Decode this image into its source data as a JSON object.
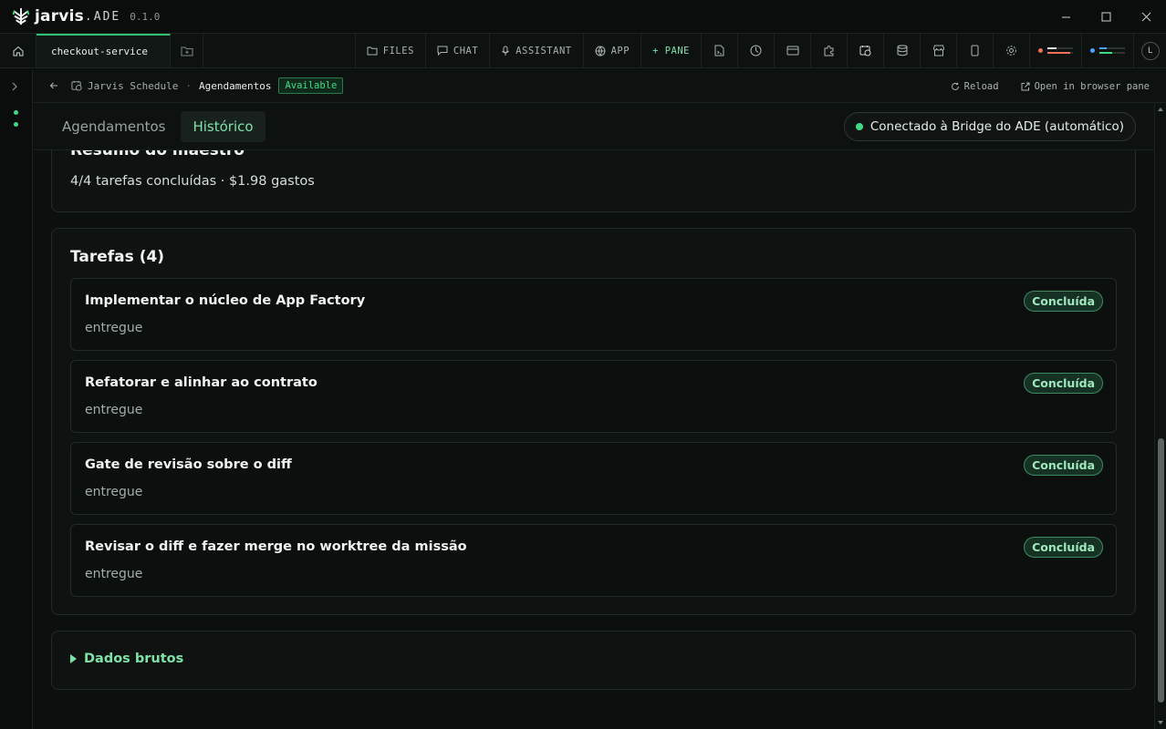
{
  "app": {
    "name": "jarvis",
    "suffix": "ADE",
    "version": "0.1.0"
  },
  "toolbar": {
    "tab": "checkout-service",
    "buttons": {
      "files": "FILES",
      "chat": "CHAT",
      "assistant": "ASSISTANT",
      "app": "APP",
      "pane": "+ PANE"
    },
    "avatar": "L",
    "meters": [
      {
        "dot_color": "#f0705a",
        "fills": [
          0.35,
          0.9
        ],
        "fill_colors": [
          "#e8e8e8",
          "#f0705a"
        ]
      },
      {
        "dot_color": "#4aa3ff",
        "fills": [
          0.3,
          0.5
        ],
        "fill_colors": [
          "#4aa3ff",
          "#3ddc84"
        ]
      }
    ]
  },
  "breadcrumb": {
    "app": "Jarvis Schedule",
    "separator": "·",
    "current": "Agendamentos",
    "status": "Available",
    "reload": "Reload",
    "open_browser": "Open in browser pane"
  },
  "tabs": {
    "agendamentos": "Agendamentos",
    "historico": "Histórico",
    "bridge": "Conectado à Bridge do ADE (automático)"
  },
  "summary": {
    "title": "Resumo do maestro",
    "text": "4/4 tarefas concluídas · $1.98 gastos"
  },
  "tasks": {
    "title": "Tarefas (4)",
    "items": [
      {
        "title": "Implementar o núcleo de App Factory",
        "subtitle": "entregue",
        "status": "Concluída"
      },
      {
        "title": "Refatorar e alinhar ao contrato",
        "subtitle": "entregue",
        "status": "Concluída"
      },
      {
        "title": "Gate de revisão sobre o diff",
        "subtitle": "entregue",
        "status": "Concluída"
      },
      {
        "title": "Revisar o diff e fazer merge no worktree da missão",
        "subtitle": "entregue",
        "status": "Concluída"
      }
    ]
  },
  "raw": {
    "label": "Dados brutos"
  },
  "colors": {
    "accent": "#3ddc84",
    "accent_light": "#7ee2a8",
    "background": "#0b0f0d"
  }
}
